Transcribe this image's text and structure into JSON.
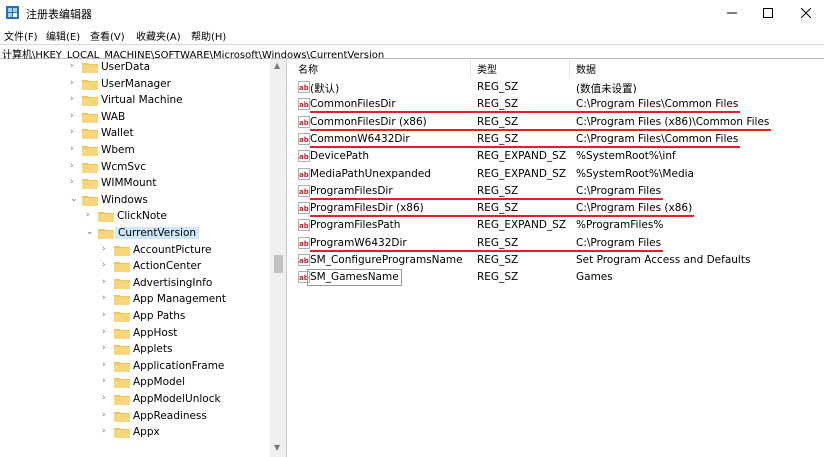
{
  "window": {
    "title": "注册表编辑器"
  },
  "menu": [
    "文件(F)",
    "编辑(E)",
    "查看(V)",
    "收藏夹(A)",
    "帮助(H)"
  ],
  "address": "计算机\\HKEY_LOCAL_MACHINE\\SOFTWARE\\Microsoft\\Windows\\CurrentVersion",
  "tree": [
    {
      "label": "UserData",
      "level": 0,
      "expanded": false
    },
    {
      "label": "UserManager",
      "level": 0,
      "expanded": false
    },
    {
      "label": "Virtual Machine",
      "level": 0,
      "expanded": false
    },
    {
      "label": "WAB",
      "level": 0,
      "expanded": false
    },
    {
      "label": "Wallet",
      "level": 0,
      "expanded": false
    },
    {
      "label": "Wbem",
      "level": 0,
      "expanded": false
    },
    {
      "label": "WcmSvc",
      "level": 0,
      "expanded": false
    },
    {
      "label": "WIMMount",
      "level": 0,
      "expanded": false
    },
    {
      "label": "Windows",
      "level": 0,
      "expanded": true
    },
    {
      "label": "ClickNote",
      "level": 1,
      "expanded": false
    },
    {
      "label": "CurrentVersion",
      "level": 1,
      "expanded": true,
      "selected": true
    },
    {
      "label": "AccountPicture",
      "level": 2,
      "expanded": false
    },
    {
      "label": "ActionCenter",
      "level": 2,
      "expanded": false
    },
    {
      "label": "AdvertisingInfo",
      "level": 2,
      "expanded": false
    },
    {
      "label": "App Management",
      "level": 2,
      "expanded": false
    },
    {
      "label": "App Paths",
      "level": 2,
      "expanded": false
    },
    {
      "label": "AppHost",
      "level": 2,
      "expanded": false
    },
    {
      "label": "Applets",
      "level": 2,
      "expanded": false
    },
    {
      "label": "ApplicationFrame",
      "level": 2,
      "expanded": false
    },
    {
      "label": "AppModel",
      "level": 2,
      "expanded": false
    },
    {
      "label": "AppModelUnlock",
      "level": 2,
      "expanded": false
    },
    {
      "label": "AppReadiness",
      "level": 2,
      "expanded": false
    },
    {
      "label": "Appx",
      "level": 2,
      "expanded": false
    }
  ],
  "columns": {
    "name": "名称",
    "type": "类型",
    "data": "数据"
  },
  "values": [
    {
      "name": "(默认)",
      "type": "REG_SZ",
      "data": "(数值未设置)",
      "underlined": false,
      "boxed": false
    },
    {
      "name": "CommonFilesDir",
      "type": "REG_SZ",
      "data": "C:\\Program Files\\Common Files",
      "underlined": true,
      "boxed": false
    },
    {
      "name": "CommonFilesDir (x86)",
      "type": "REG_SZ",
      "data": "C:\\Program Files (x86)\\Common Files",
      "underlined": true,
      "boxed": false
    },
    {
      "name": "CommonW6432Dir",
      "type": "REG_SZ",
      "data": "C:\\Program Files\\Common Files",
      "underlined": true,
      "boxed": false
    },
    {
      "name": "DevicePath",
      "type": "REG_EXPAND_SZ",
      "data": "%SystemRoot%\\inf",
      "underlined": false,
      "boxed": false
    },
    {
      "name": "MediaPathUnexpanded",
      "type": "REG_EXPAND_SZ",
      "data": "%SystemRoot%\\Media",
      "underlined": false,
      "boxed": false
    },
    {
      "name": "ProgramFilesDir",
      "type": "REG_SZ",
      "data": "C:\\Program Files",
      "underlined": true,
      "boxed": false
    },
    {
      "name": "ProgramFilesDir (x86)",
      "type": "REG_SZ",
      "data": "C:\\Program Files (x86)",
      "underlined": true,
      "boxed": false
    },
    {
      "name": "ProgramFilesPath",
      "type": "REG_EXPAND_SZ",
      "data": "%ProgramFiles%",
      "underlined": false,
      "boxed": false
    },
    {
      "name": "ProgramW6432Dir",
      "type": "REG_SZ",
      "data": "C:\\Program Files",
      "underlined": true,
      "boxed": false
    },
    {
      "name": "SM_ConfigureProgramsName",
      "type": "REG_SZ",
      "data": "Set Program Access and Defaults",
      "underlined": false,
      "boxed": false
    },
    {
      "name": "SM_GamesName",
      "type": "REG_SZ",
      "data": "Games",
      "underlined": false,
      "boxed": true
    }
  ],
  "colors": {
    "annotation": "#e0202a",
    "folder": "#f2c55c",
    "selection": "#cde8ff"
  },
  "icons": {
    "app": "registry-editor-icon",
    "value": "string-value-ab-icon",
    "key": "folder-icon"
  }
}
